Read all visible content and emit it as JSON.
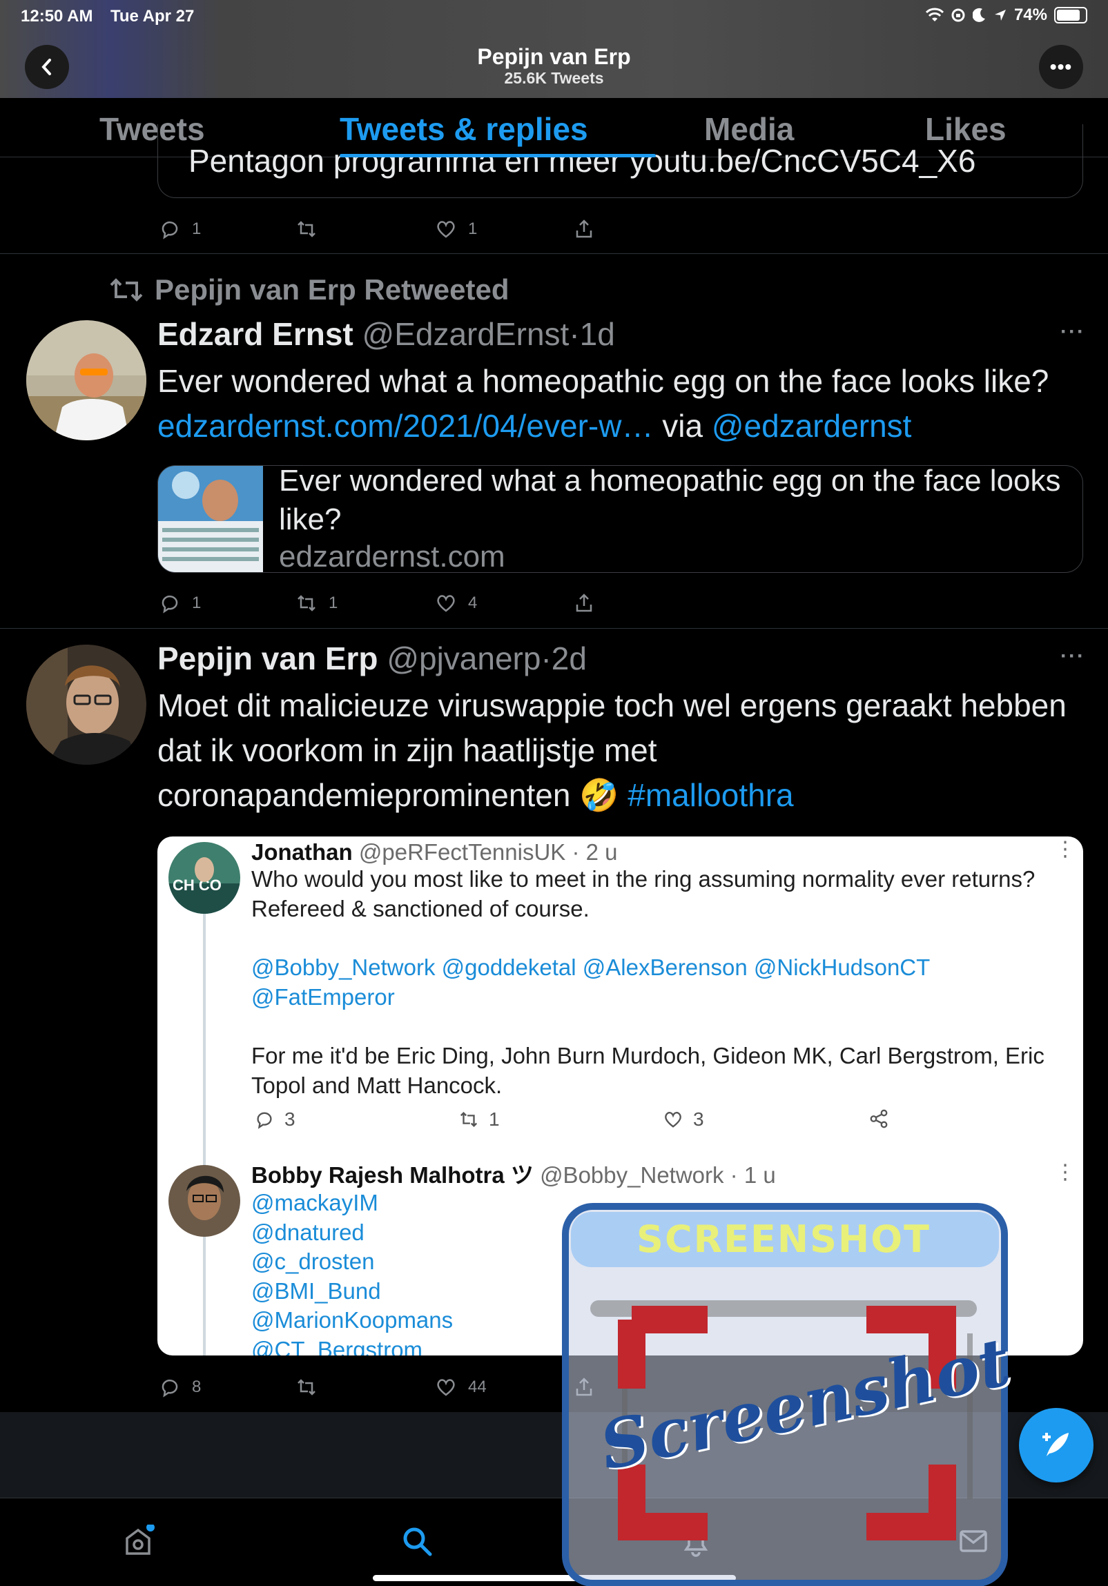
{
  "status": {
    "time": "12:50 AM",
    "date": "Tue Apr 27",
    "battery": "74%"
  },
  "header": {
    "name": "Pepijn van Erp",
    "tweet_count": "25.6K Tweets"
  },
  "tabs": [
    {
      "label": "Tweets"
    },
    {
      "label": "Tweets & replies",
      "active": true
    },
    {
      "label": "Media"
    },
    {
      "label": "Likes"
    }
  ],
  "prev_tweet": {
    "card_text": "Pentagon programma en meer youtu.be/CncCV5C4_X6",
    "replies": "1",
    "retweets": "",
    "likes": "1"
  },
  "retweet": {
    "context": "Pepijn van Erp Retweeted",
    "author": "Edzard Ernst",
    "handle": "@EdzardErnst",
    "dot": "·",
    "time": "1d",
    "text": "Ever wondered what a homeopathic egg on the face looks like?",
    "link": "edzardernst.com/2021/04/ever-w…",
    "via": "via",
    "via_handle": "@edzardernst",
    "card_title": "Ever wondered what a homeopathic egg on the face looks like?",
    "card_domain": "edzardernst.com",
    "replies": "1",
    "retweets": "1",
    "likes": "4"
  },
  "tweet": {
    "author": "Pepijn van Erp",
    "handle": "@pjvanerp",
    "dot": "·",
    "time": "2d",
    "text": "Moet dit malicieuze viruswappie toch wel ergens geraakt hebben dat ik voorkom in zijn haatlijstje met coronapandemieprominenten 🤣",
    "hashtag": "#malloothra",
    "replies": "8",
    "retweets": "",
    "likes": "44"
  },
  "embedded": {
    "first": {
      "author": "Jonathan",
      "handle": "@peRFectTennisUK · 2 u",
      "text1": "Who would you most like to meet in the ring assuming normality ever returns? Refereed & sanctioned of course.",
      "mentions": "@Bobby_Network @goddeketal @AlexBerenson @NickHudsonCT @FatEmperor",
      "text2": "For me it'd be Eric Ding, John Burn Murdoch, Gideon MK, Carl Bergstrom, Eric Topol and Matt Hancock.",
      "replies": "3",
      "retweets": "1",
      "likes": "3"
    },
    "second": {
      "author": "Bobby Rajesh Malhotra ツ",
      "handle": "@Bobby_Network · 1 u",
      "mentions": [
        "@mackayIM",
        "@dnatured",
        "@c_drosten",
        "@BMI_Bund",
        "@MarionKoopmans",
        "@CT_Bergstrom"
      ]
    }
  },
  "overlay": {
    "banner": "SCREENSHOT",
    "script": "Screenshot"
  },
  "colors": {
    "accent": "#1d9bf0",
    "background": "#000000",
    "muted": "#8a8d91"
  }
}
